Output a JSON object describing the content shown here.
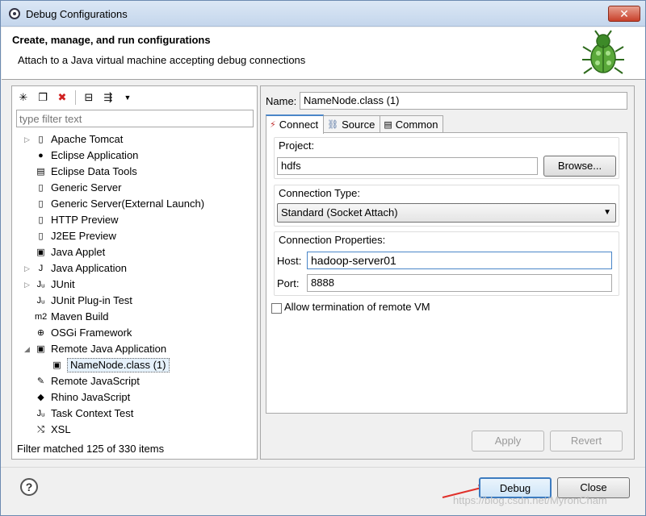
{
  "window": {
    "title": "Debug Configurations"
  },
  "header": {
    "title": "Create, manage, and run configurations",
    "subtitle": "Attach to a Java virtual machine accepting debug connections"
  },
  "left": {
    "filter_placeholder": "type filter text",
    "tree": [
      {
        "label": "Apache Tomcat",
        "expander": "▷",
        "icon": "tomcat-icon",
        "glyph": "▯"
      },
      {
        "label": "Eclipse Application",
        "expander": "",
        "icon": "eclipse-icon",
        "glyph": "●"
      },
      {
        "label": "Eclipse Data Tools",
        "expander": "",
        "icon": "database-icon",
        "glyph": "▤"
      },
      {
        "label": "Generic Server",
        "expander": "",
        "icon": "server-icon",
        "glyph": "▯"
      },
      {
        "label": "Generic Server(External Launch)",
        "expander": "",
        "icon": "server-icon",
        "glyph": "▯"
      },
      {
        "label": "HTTP Preview",
        "expander": "",
        "icon": "server-icon",
        "glyph": "▯"
      },
      {
        "label": "J2EE Preview",
        "expander": "",
        "icon": "server-icon",
        "glyph": "▯"
      },
      {
        "label": "Java Applet",
        "expander": "",
        "icon": "applet-icon",
        "glyph": "▣"
      },
      {
        "label": "Java Application",
        "expander": "▷",
        "icon": "java-app-icon",
        "glyph": "J"
      },
      {
        "label": "JUnit",
        "expander": "▷",
        "icon": "junit-icon",
        "glyph": "Jᵤ"
      },
      {
        "label": "JUnit Plug-in Test",
        "expander": "",
        "icon": "junit-plugin-icon",
        "glyph": "Jᵤ"
      },
      {
        "label": "Maven Build",
        "expander": "",
        "icon": "maven-icon",
        "glyph": "m2"
      },
      {
        "label": "OSGi Framework",
        "expander": "",
        "icon": "osgi-icon",
        "glyph": "⊕"
      },
      {
        "label": "Remote Java Application",
        "expander": "◢",
        "icon": "remote-java-icon",
        "glyph": "▣"
      },
      {
        "label": "NameNode.class (1)",
        "expander": "",
        "icon": "remote-config-icon",
        "glyph": "▣",
        "child": true
      },
      {
        "label": "Remote JavaScript",
        "expander": "",
        "icon": "remote-js-icon",
        "glyph": "✎"
      },
      {
        "label": "Rhino JavaScript",
        "expander": "",
        "icon": "rhino-icon",
        "glyph": "◆"
      },
      {
        "label": "Task Context Test",
        "expander": "",
        "icon": "task-context-icon",
        "glyph": "Jᵤ"
      },
      {
        "label": "XSL",
        "expander": "",
        "icon": "xsl-icon",
        "glyph": "⤭"
      }
    ],
    "status": "Filter matched 125 of 330 items"
  },
  "right": {
    "name_label": "Name:",
    "name_value": "NameNode.class (1)",
    "tabs": [
      {
        "label": "Connect",
        "icon": "connect-icon",
        "glyph": "⚡",
        "active": true
      },
      {
        "label": "Source",
        "icon": "source-icon",
        "glyph": "⛓",
        "active": false
      },
      {
        "label": "Common",
        "icon": "common-icon",
        "glyph": "▤",
        "active": false
      }
    ],
    "project_label": "Project:",
    "project_value": "hdfs",
    "browse_label": "Browse...",
    "conn_type_label": "Connection Type:",
    "conn_type_value": "Standard (Socket Attach)",
    "conn_props_label": "Connection Properties:",
    "host_label": "Host:",
    "host_value": "hadoop-server01",
    "port_label": "Port:",
    "port_value": "8888",
    "allow_term_label": "Allow termination of remote VM",
    "apply_label": "Apply",
    "revert_label": "Revert"
  },
  "footer": {
    "help_glyph": "?",
    "debug_label": "Debug",
    "close_label": "Close",
    "watermark": "https://blog.csdn.net/MyronCham"
  },
  "colors": {
    "accent": "#3d7bbf",
    "arrow": "#e0302a"
  }
}
